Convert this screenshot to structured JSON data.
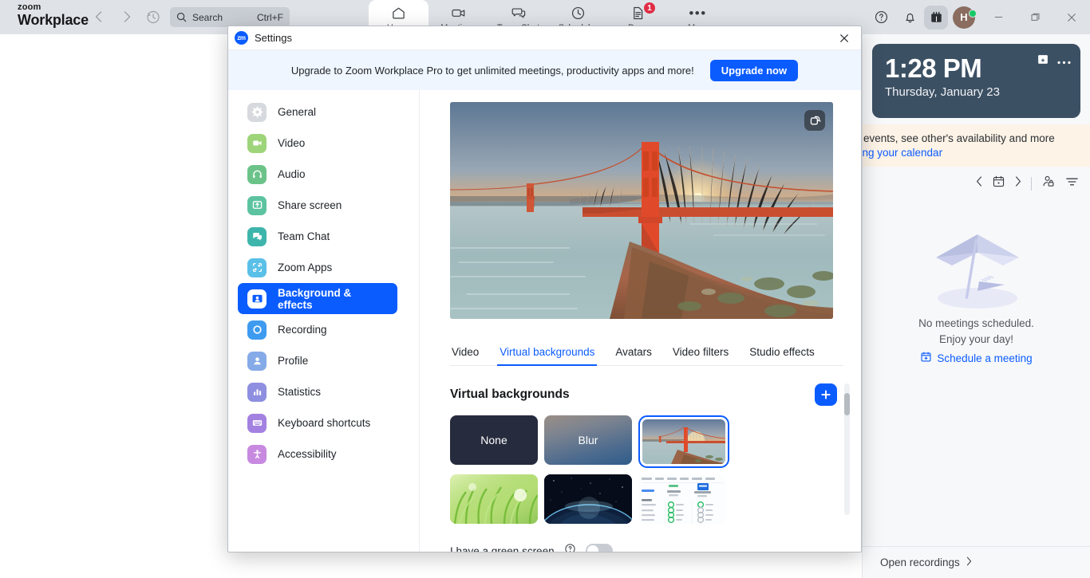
{
  "app": {
    "brand_top": "zoom",
    "brand_bottom": "Workplace",
    "search": {
      "label": "Search",
      "shortcut": "Ctrl+F",
      "icon": "search-icon"
    },
    "nav_back_icon": "chevron-left-icon",
    "nav_forward_icon": "chevron-right-icon",
    "history_icon": "history-clock-icon",
    "tabs": [
      {
        "label": "Home",
        "icon": "home-icon",
        "active": true,
        "badge": ""
      },
      {
        "label": "Meetings",
        "icon": "video-camera-icon",
        "active": false,
        "badge": ""
      },
      {
        "label": "Team Chat",
        "icon": "chat-bubbles-icon",
        "active": false,
        "badge": ""
      },
      {
        "label": "Scheduler",
        "icon": "clock-icon",
        "active": false,
        "badge": ""
      },
      {
        "label": "Docs",
        "icon": "document-icon",
        "active": false,
        "badge": "1"
      },
      {
        "label": "More",
        "icon": "ellipsis-icon",
        "active": false,
        "badge": ""
      }
    ],
    "header_actions": [
      {
        "name": "help-icon"
      },
      {
        "name": "bell-notification-icon"
      },
      {
        "name": "gift-calendar-icon"
      }
    ],
    "avatar_initial": "H",
    "window_controls": {
      "minimize": "minimize-icon",
      "maximize": "restore-icon",
      "close": "close-icon"
    }
  },
  "right_panel": {
    "clock": {
      "time": "1:28 PM",
      "date": "Thursday, January 23"
    },
    "clock_actions": [
      "add-calendar-icon",
      "more-options-icon"
    ],
    "calendar_promo": {
      "line1": "to events, see other's availability and more",
      "line2": "cting your calendar"
    },
    "calendar_toolbar": [
      "previous-day-icon",
      "today-calendar-icon",
      "next-day-icon",
      "availability-icon",
      "filter-icon"
    ],
    "empty_state": {
      "line1": "No meetings scheduled.",
      "line2": "Enjoy your day!",
      "link": "Schedule a meeting",
      "link_icon": "calendar-plus-icon",
      "illustration": "beach-umbrella-illustration"
    },
    "open_recordings": {
      "label": "Open recordings",
      "icon": "chevron-right-icon"
    }
  },
  "dialog": {
    "title": "Settings",
    "logo_text": "zm",
    "close_icon": "close-icon",
    "banner": {
      "text": "Upgrade to Zoom Workplace Pro to get unlimited meetings, productivity apps and more!",
      "button": "Upgrade now"
    },
    "sidebar": {
      "items": [
        {
          "label": "General",
          "icon": "gear-icon",
          "color": "#d6d9dd",
          "glyph": "#ffffff",
          "active": false
        },
        {
          "label": "Video",
          "icon": "video-camera-icon",
          "color": "#9ed47a",
          "glyph": "#ffffff",
          "active": false
        },
        {
          "label": "Audio",
          "icon": "headphones-icon",
          "color": "#6cc389",
          "glyph": "#ffffff",
          "active": false
        },
        {
          "label": "Share screen",
          "icon": "share-screen-icon",
          "color": "#5cc3a0",
          "glyph": "#ffffff",
          "active": false
        },
        {
          "label": "Team Chat",
          "icon": "chat-bubbles-icon",
          "color": "#3eb5ab",
          "glyph": "#ffffff",
          "active": false
        },
        {
          "label": "Zoom Apps",
          "icon": "zoom-apps-icon",
          "color": "#5bc0e8",
          "glyph": "#ffffff",
          "active": false
        },
        {
          "label": "Background & effects",
          "icon": "person-frame-icon",
          "color": "#0b5cff",
          "glyph": "#ffffff",
          "active": true
        },
        {
          "label": "Recording",
          "icon": "record-circle-icon",
          "color": "#3e9bf0",
          "glyph": "#ffffff",
          "active": false
        },
        {
          "label": "Profile",
          "icon": "person-icon",
          "color": "#85aae8",
          "glyph": "#ffffff",
          "active": false
        },
        {
          "label": "Statistics",
          "icon": "bar-chart-icon",
          "color": "#8e8fe0",
          "glyph": "#ffffff",
          "active": false
        },
        {
          "label": "Keyboard shortcuts",
          "icon": "keyboard-icon",
          "color": "#a381e0",
          "glyph": "#ffffff",
          "active": false
        },
        {
          "label": "Accessibility",
          "icon": "accessibility-icon",
          "color": "#c88ae0",
          "glyph": "#ffffff",
          "active": false
        }
      ]
    },
    "main": {
      "preview": {
        "name": "video-preview",
        "image": "golden-gate-bridge-sunset",
        "mirror_icon": "mirror-video-icon"
      },
      "tabs": [
        {
          "label": "Video",
          "active": false
        },
        {
          "label": "Virtual backgrounds",
          "active": true
        },
        {
          "label": "Avatars",
          "active": false
        },
        {
          "label": "Video filters",
          "active": false
        },
        {
          "label": "Studio effects",
          "active": false
        }
      ],
      "section_title": "Virtual backgrounds",
      "add_button_icon": "plus-icon",
      "backgrounds": [
        {
          "label": "None",
          "kind": "none",
          "selected": false
        },
        {
          "label": "Blur",
          "kind": "blur",
          "selected": false
        },
        {
          "label": "",
          "kind": "bridge",
          "selected": true
        },
        {
          "label": "",
          "kind": "grass",
          "selected": false
        },
        {
          "label": "",
          "kind": "space",
          "selected": false
        },
        {
          "label": "",
          "kind": "doc",
          "selected": false
        }
      ],
      "green_screen": {
        "label": "I have a green screen",
        "help_icon": "help-circle-icon",
        "enabled": false
      }
    }
  },
  "colors": {
    "accent": "#0b5cff",
    "header_bg": "#dfe3e8",
    "banner_bg": "#f0f6ff",
    "clock_bg": "#3c5063",
    "promo_bg": "#fdf3e7",
    "badge_red": "#e02d45",
    "presence_green": "#17c964"
  }
}
